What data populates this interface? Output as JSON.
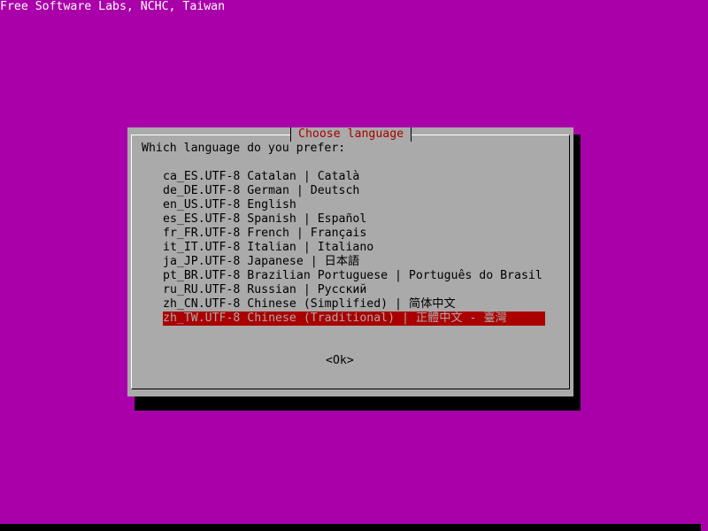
{
  "backtitle": "Free Software Labs, NCHC, Taiwan",
  "dialog": {
    "title": "Choose language",
    "prompt": "Which language do you prefer:",
    "ok_label": "<Ok>"
  },
  "languages": [
    {
      "code": "ca_ES.UTF-8",
      "label": "Catalan | Català",
      "selected": false
    },
    {
      "code": "de_DE.UTF-8",
      "label": "German | Deutsch",
      "selected": false
    },
    {
      "code": "en_US.UTF-8",
      "label": "English",
      "selected": false
    },
    {
      "code": "es_ES.UTF-8",
      "label": "Spanish | Español",
      "selected": false
    },
    {
      "code": "fr_FR.UTF-8",
      "label": "French | Français",
      "selected": false
    },
    {
      "code": "it_IT.UTF-8",
      "label": "Italian | Italiano",
      "selected": false
    },
    {
      "code": "ja_JP.UTF-8",
      "label": "Japanese | 日本語",
      "selected": false
    },
    {
      "code": "pt_BR.UTF-8",
      "label": "Brazilian Portuguese | Português do Brasil",
      "selected": false
    },
    {
      "code": "ru_RU.UTF-8",
      "label": "Russian | Русский",
      "selected": false
    },
    {
      "code": "zh_CN.UTF-8",
      "label": "Chinese (Simplified) | 简体中文",
      "selected": false
    },
    {
      "code": "zh_TW.UTF-8",
      "label": "Chinese (Traditional) | 正體中文 - 臺灣",
      "selected": true
    }
  ],
  "colors": {
    "background": "#aa00aa",
    "dialog": "#aaaaaa",
    "title": "#aa0000",
    "selection": "#aa0000",
    "cursor": "#55ffff"
  }
}
